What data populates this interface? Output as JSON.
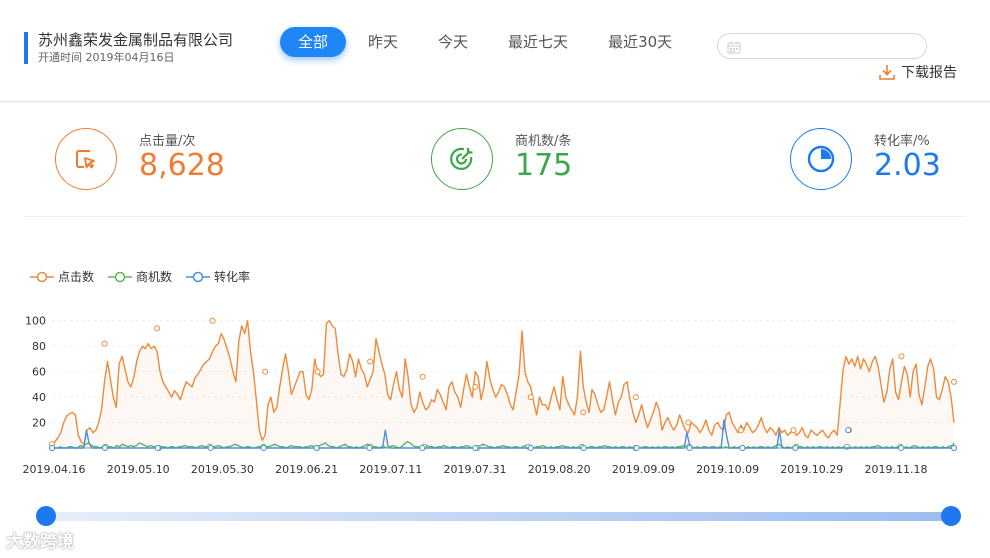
{
  "header": {
    "company_name": "苏州鑫荣发金属制品有限公司",
    "open_date": "开通时间 2019年04月16日",
    "tabs": [
      {
        "label": "全部",
        "active": true
      },
      {
        "label": "昨天",
        "active": false
      },
      {
        "label": "今天",
        "active": false
      },
      {
        "label": "最近七天",
        "active": false
      },
      {
        "label": "最近30天",
        "active": false
      }
    ],
    "date_range_placeholder": "",
    "download_label": "下载报告",
    "accent_color": "#1e86f5"
  },
  "stats": [
    {
      "label": "点击量/次",
      "value": "8,628",
      "color": "#ee7d33",
      "icon": "click-cursor-icon"
    },
    {
      "label": "商机数/条",
      "value": "175",
      "color": "#3ea64b",
      "icon": "target-icon"
    },
    {
      "label": "转化率/%",
      "value": "2.03",
      "color": "#1e78f0",
      "icon": "pie-chart-icon"
    }
  ],
  "chart_data": {
    "type": "line",
    "legend": [
      "点击数",
      "商机数",
      "转化率"
    ],
    "series_colors": [
      "#ee8a3c",
      "#5cb65f",
      "#4a8fe0"
    ],
    "y_ticks": [
      20,
      40,
      60,
      80,
      100
    ],
    "ylim": [
      0,
      110
    ],
    "x_tick_labels": [
      "2019.04.16",
      "2019.05.10",
      "2019.05.30",
      "2019.06.21",
      "2019.07.11",
      "2019.07.31",
      "2019.08.20",
      "2019.09.09",
      "2019.10.09",
      "2019.10.29",
      "2019.11.18"
    ],
    "series": [
      {
        "name": "点击数",
        "values": [
          3,
          5,
          8,
          12,
          20,
          25,
          27,
          28,
          26,
          10,
          5,
          3,
          14,
          16,
          12,
          14,
          20,
          30,
          52,
          68,
          54,
          40,
          32,
          66,
          72,
          62,
          52,
          48,
          55,
          68,
          76,
          80,
          78,
          82,
          78,
          80,
          76,
          60,
          52,
          48,
          44,
          40,
          45,
          42,
          38,
          46,
          52,
          50,
          48,
          55,
          58,
          62,
          66,
          68,
          70,
          76,
          80,
          82,
          90,
          85,
          78,
          70,
          60,
          52,
          84,
          96,
          90,
          100,
          76,
          60,
          38,
          14,
          6,
          10,
          34,
          40,
          28,
          32,
          48,
          62,
          74,
          60,
          42,
          48,
          54,
          60,
          60,
          42,
          38,
          46,
          70,
          60,
          56,
          58,
          98,
          100,
          96,
          94,
          74,
          58,
          56,
          62,
          74,
          68,
          56,
          70,
          62,
          58,
          48,
          54,
          60,
          86,
          76,
          66,
          58,
          42,
          38,
          50,
          60,
          46,
          40,
          70,
          56,
          34,
          28,
          32,
          44,
          36,
          30,
          32,
          38,
          36,
          46,
          42,
          36,
          30,
          48,
          52,
          44,
          40,
          32,
          46,
          58,
          48,
          40,
          60,
          56,
          38,
          48,
          68,
          54,
          46,
          40,
          44,
          50,
          48,
          42,
          34,
          30,
          44,
          58,
          92,
          60,
          52,
          48,
          36,
          26,
          40,
          34,
          34,
          30,
          40,
          48,
          38,
          30,
          56,
          40,
          34,
          30,
          26,
          40,
          76,
          48,
          36,
          28,
          46,
          42,
          34,
          28,
          30,
          40,
          52,
          38,
          26,
          36,
          40,
          50,
          52,
          38,
          28,
          20,
          26,
          34,
          24,
          16,
          22,
          28,
          36,
          30,
          14,
          20,
          24,
          18,
          14,
          18,
          26,
          20,
          14,
          12,
          20,
          18,
          16,
          12,
          16,
          22,
          14,
          10,
          18,
          20,
          16,
          14,
          26,
          28,
          20,
          16,
          12,
          18,
          14,
          20,
          16,
          12,
          14,
          18,
          24,
          16,
          12,
          16,
          14,
          10,
          16,
          12,
          14,
          10,
          12,
          14,
          10,
          12,
          16,
          10,
          8,
          14,
          12,
          10,
          12,
          14,
          10,
          8,
          12,
          14,
          10,
          36,
          62,
          72,
          66,
          70,
          64,
          72,
          62,
          70,
          66,
          60,
          68,
          72,
          64,
          50,
          36,
          44,
          62,
          70,
          44,
          38,
          52,
          64,
          58,
          40,
          60,
          66,
          42,
          34,
          48,
          64,
          70,
          62,
          40,
          38,
          46,
          56,
          52,
          40,
          20
        ],
        "markers": [
          3,
          82,
          94,
          100,
          60,
          60,
          68,
          56,
          48,
          40,
          28,
          40,
          20,
          14,
          14,
          14,
          72,
          52
        ]
      },
      {
        "name": "商机数",
        "values": [
          1,
          0,
          0,
          1,
          0,
          0,
          1,
          1,
          0,
          0,
          2,
          1,
          3,
          4,
          2,
          1,
          1,
          0,
          1,
          2,
          1,
          1,
          0,
          2,
          1,
          3,
          2,
          1,
          2,
          1,
          2,
          4,
          3,
          2,
          1,
          2,
          1,
          1,
          0,
          1,
          1,
          0,
          1,
          1,
          0,
          1,
          1,
          2,
          1,
          1,
          1,
          0,
          1,
          2,
          1,
          1,
          0,
          1,
          1,
          2,
          1,
          0,
          1,
          1,
          2,
          3,
          2,
          1,
          0,
          1,
          1,
          0,
          0,
          1,
          1,
          2,
          1,
          1,
          2,
          3,
          2,
          1,
          1,
          0,
          1,
          2,
          1,
          1,
          1,
          0,
          1,
          1,
          2,
          1,
          1,
          2,
          3,
          4,
          2,
          1,
          1,
          0,
          1,
          2,
          3,
          1,
          1,
          0,
          1,
          0,
          1,
          2,
          3,
          2,
          1,
          1,
          0,
          1,
          1,
          0,
          1,
          2,
          1,
          0,
          1,
          3,
          5,
          4,
          2,
          1,
          1,
          0,
          1,
          2,
          1,
          1,
          0,
          1,
          1,
          2,
          1,
          0,
          1,
          1,
          0,
          1,
          1,
          2,
          1,
          0,
          1,
          1,
          2,
          3,
          2,
          1,
          1,
          0,
          1,
          1,
          2,
          1,
          1,
          0,
          1,
          1,
          0,
          1,
          2,
          1,
          1,
          0,
          1,
          1,
          2,
          1,
          0,
          1,
          0,
          1,
          1,
          2,
          1,
          1,
          0,
          1,
          0,
          1,
          1,
          1,
          0,
          1,
          1,
          0,
          1,
          1,
          2,
          1,
          1,
          0,
          1,
          0,
          1,
          1,
          0,
          1,
          0,
          1,
          1,
          0,
          1,
          1,
          0,
          1,
          0,
          1,
          0,
          1,
          1,
          0,
          1,
          0,
          1,
          1,
          2,
          1,
          0,
          1,
          0,
          1,
          0,
          1,
          1,
          0,
          1,
          1,
          0,
          1,
          0,
          1,
          0,
          0,
          1,
          0,
          1,
          1,
          0,
          1,
          0,
          1,
          0,
          1,
          1,
          0,
          1,
          0,
          1,
          2,
          3,
          1,
          0,
          1,
          0,
          1,
          0,
          1,
          1,
          0,
          1,
          0,
          1,
          0,
          1,
          1,
          0,
          1,
          0,
          1,
          0,
          1,
          0,
          1,
          2,
          1,
          0,
          1,
          0,
          1,
          0,
          1,
          0,
          1,
          1,
          2,
          1,
          0,
          1,
          0,
          1,
          0,
          1,
          1,
          0,
          1,
          0,
          1,
          2,
          1,
          0,
          1,
          0,
          1,
          0,
          1,
          1,
          0,
          1,
          0,
          1,
          2,
          1
        ],
        "markers": [
          0,
          1,
          0,
          1,
          1,
          0,
          1,
          1,
          0,
          1,
          1,
          0,
          1,
          0,
          1,
          1,
          1,
          0
        ]
      },
      {
        "name": "转化率",
        "values": [
          0,
          0,
          0,
          0,
          0,
          0,
          0,
          0,
          0,
          0,
          0,
          0,
          0,
          14,
          4,
          0,
          0,
          0,
          0,
          0,
          0,
          0,
          0,
          0,
          0,
          0,
          0,
          0,
          0,
          0,
          0,
          0,
          0,
          0,
          0,
          0,
          0,
          0,
          0,
          0,
          0,
          0,
          0,
          0,
          0,
          0,
          0,
          0,
          0,
          0,
          0,
          0,
          0,
          0,
          0,
          0,
          0,
          0,
          0,
          0,
          0,
          0,
          0,
          0,
          0,
          0,
          0,
          0,
          0,
          0,
          0,
          0,
          0,
          0,
          0,
          0,
          0,
          0,
          0,
          0,
          0,
          0,
          0,
          0,
          0,
          0,
          0,
          0,
          0,
          0,
          0,
          0,
          0,
          0,
          0,
          0,
          0,
          0,
          0,
          0,
          0,
          0,
          0,
          0,
          0,
          0,
          0,
          0,
          0,
          0,
          0,
          0,
          0,
          0,
          0,
          0,
          0,
          0,
          0,
          0,
          0,
          0,
          0,
          0,
          0,
          0,
          14,
          2,
          0,
          0,
          0,
          0,
          0,
          0,
          0,
          0,
          0,
          0,
          0,
          0,
          0,
          0,
          0,
          0,
          0,
          0,
          0,
          0,
          0,
          0,
          0,
          0,
          0,
          0,
          0,
          0,
          0,
          0,
          0,
          0,
          0,
          0,
          0,
          0,
          0,
          0,
          0,
          0,
          0,
          0,
          0,
          0,
          0,
          0,
          0,
          0,
          0,
          0,
          0,
          0,
          0,
          0,
          0,
          0,
          0,
          0,
          0,
          0,
          0,
          0,
          0,
          0,
          0,
          0,
          0,
          0,
          0,
          0,
          0,
          0,
          0,
          0,
          0,
          0,
          0,
          0,
          0,
          0,
          0,
          0,
          0,
          0,
          0,
          0,
          0,
          0,
          0,
          0,
          0,
          0,
          0,
          0,
          0,
          0,
          0,
          0,
          0,
          0,
          0,
          0,
          0,
          0,
          0,
          0,
          0,
          0,
          0,
          0,
          0,
          0,
          12,
          3,
          0,
          0,
          0,
          0,
          0,
          0,
          0,
          0,
          0,
          0,
          0,
          0,
          22,
          10,
          0,
          0,
          0,
          0,
          0,
          0,
          0,
          0,
          0,
          0,
          0,
          0,
          0,
          0,
          0,
          0,
          0,
          0,
          0,
          14,
          0,
          0,
          0,
          0,
          0,
          0,
          0,
          0,
          0,
          0,
          0,
          0,
          0,
          0,
          0,
          0,
          0,
          0,
          0,
          0,
          0,
          0,
          0,
          0,
          0,
          0,
          0,
          0,
          0,
          0,
          0,
          0,
          0,
          0,
          0,
          0,
          0,
          0,
          0,
          0,
          0,
          0,
          0,
          0,
          0,
          0,
          0,
          0,
          0,
          0,
          0,
          0,
          0,
          0,
          0,
          0,
          0,
          0,
          0,
          0,
          0,
          0,
          0,
          0,
          0,
          4
        ],
        "markers": [
          0,
          0,
          0,
          0,
          0,
          0,
          0,
          0,
          0,
          0,
          0,
          0,
          0,
          0,
          0,
          14,
          0,
          0
        ]
      }
    ]
  },
  "slider": {
    "start": 0,
    "end": 1
  },
  "watermark": "大数跨境"
}
